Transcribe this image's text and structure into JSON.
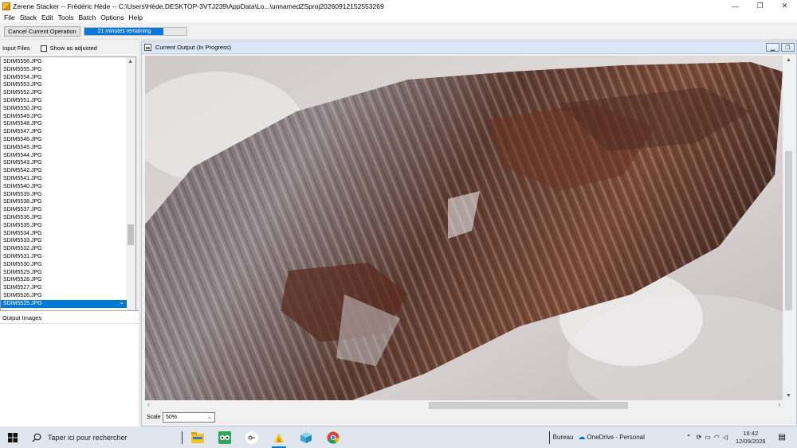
{
  "window": {
    "title": "Zerene Stacker -- Frédéric Hède -- C:\\Users\\Hède.DESKTOP-3VTJ239\\AppData\\Lo...\\unnamedZSproj20260912152553269",
    "minimize": "—",
    "maximize": "❐",
    "close": "✕"
  },
  "menu": {
    "items": [
      "File",
      "Stack",
      "Edit",
      "Tools",
      "Batch",
      "Options",
      "Help"
    ]
  },
  "toolbar": {
    "cancel_label": "Cancel Current Operation",
    "progress_text": "21 minutes remaining",
    "progress_fraction": 0.77
  },
  "input_files": {
    "label": "Input Files",
    "show_adjusted_label": "Show as adjusted",
    "show_adjusted_checked": false,
    "files": [
      "SDIM5556.JPG",
      "SDIM5555.JPG",
      "SDIM5554.JPG",
      "SDIM5553.JPG",
      "SDIM5552.JPG",
      "SDIM5551.JPG",
      "SDIM5550.JPG",
      "SDIM5549.JPG",
      "SDIM5548.JPG",
      "SDIM5547.JPG",
      "SDIM5546.JPG",
      "SDIM5545.JPG",
      "SDIM5544.JPG",
      "SDIM5543.JPG",
      "SDIM5542.JPG",
      "SDIM5541.JPG",
      "SDIM5540.JPG",
      "SDIM5539.JPG",
      "SDIM5538.JPG",
      "SDIM5537.JPG",
      "SDIM5536.JPG",
      "SDIM5535.JPG",
      "SDIM5534.JPG",
      "SDIM5533.JPG",
      "SDIM5532.JPG",
      "SDIM5531.JPG",
      "SDIM5530.JPG",
      "SDIM5529.JPG",
      "SDIM5528.JPG",
      "SDIM5527.JPG",
      "SDIM5526.JPG",
      "SDIM5525.JPG"
    ],
    "selected_file": "SDIM5525.JPG"
  },
  "output_images": {
    "label": "Output Images"
  },
  "current_output": {
    "title": "Current Output (In Progress)",
    "scale_label": "Scale",
    "scale_value": "50%"
  },
  "taskbar": {
    "search_placeholder": "Taper ici pour rechercher",
    "tray_bureau": "Bureau",
    "tray_onedrive": "OneDrive - Personal",
    "time": "16:42",
    "date": "12/09/2026"
  }
}
